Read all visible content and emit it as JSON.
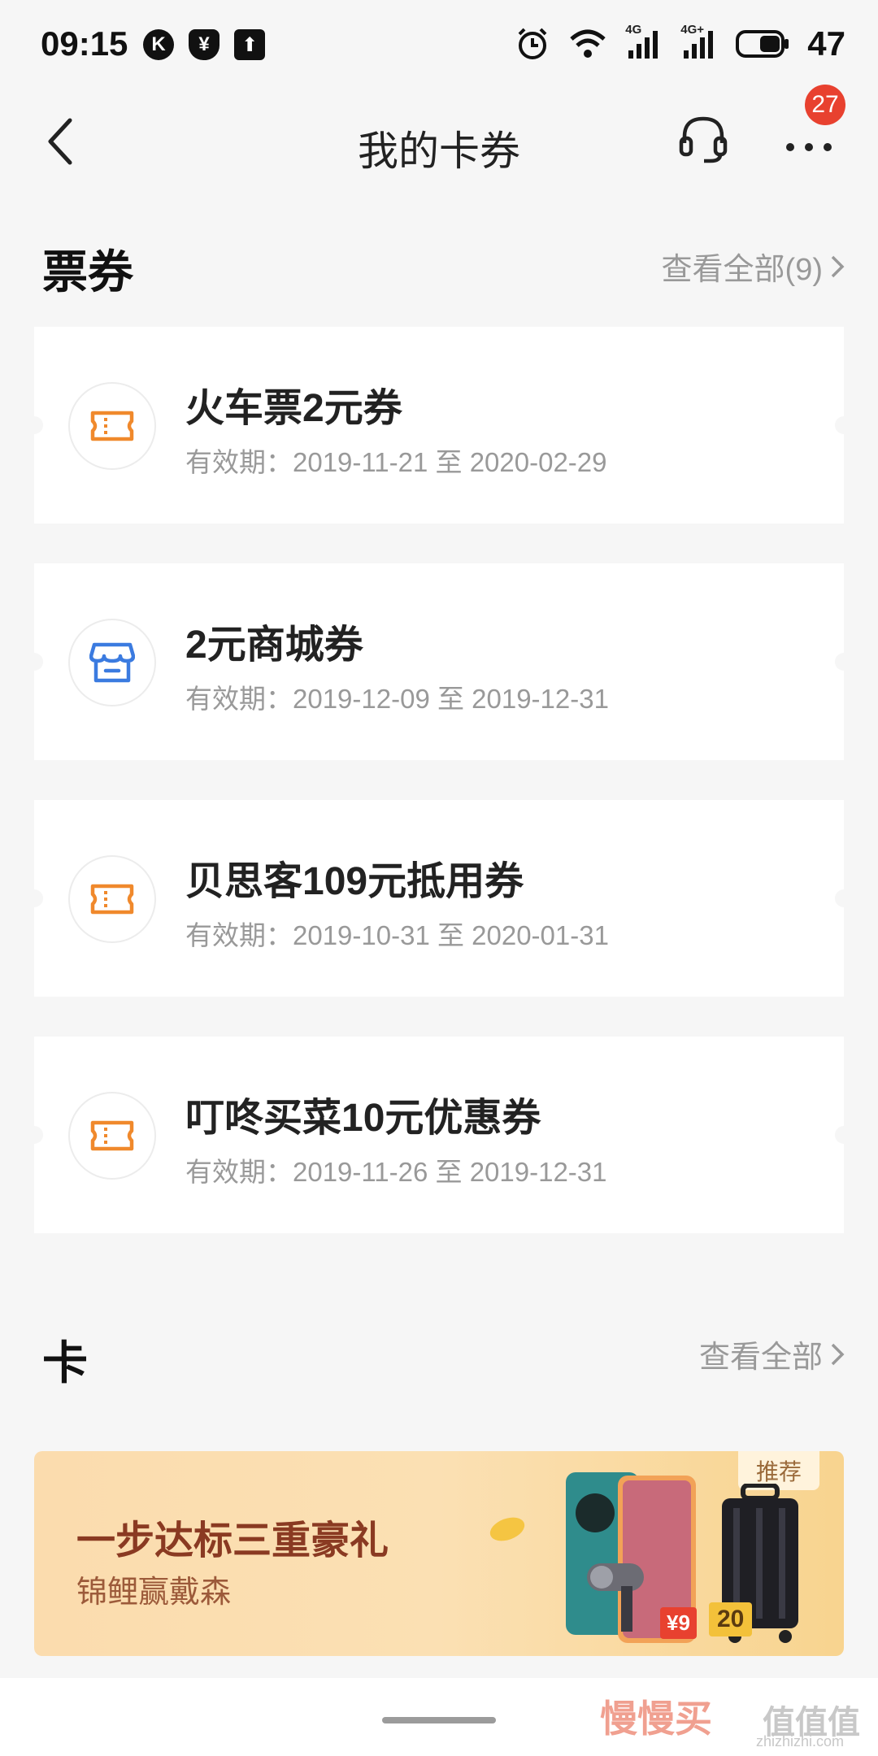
{
  "status": {
    "time": "09:15",
    "battery": "47",
    "net1": "4G",
    "net2": "4G+"
  },
  "nav": {
    "title": "我的卡券",
    "badge": "27"
  },
  "tickets_section": {
    "title": "票券",
    "view_all": "查看全部(9)"
  },
  "coupons": [
    {
      "title": "火车票2元券",
      "date": "有效期：2019-11-21 至 2020-02-29",
      "icon": "ticket-icon"
    },
    {
      "title": "2元商城券",
      "date": "有效期：2019-12-09 至 2019-12-31",
      "icon": "store-icon"
    },
    {
      "title": "贝思客109元抵用券",
      "date": "有效期：2019-10-31 至 2020-01-31",
      "icon": "ticket-icon"
    },
    {
      "title": "叮咚买菜10元优惠券",
      "date": "有效期：2019-11-26 至 2019-12-31",
      "icon": "ticket-icon"
    }
  ],
  "cards_section": {
    "title": "卡",
    "view_all": "查看全部"
  },
  "banner": {
    "title": "一步达标三重豪礼",
    "subtitle": "锦鲤赢戴森",
    "tag": "推荐",
    "price1": "¥9",
    "price2": "20"
  },
  "watermark": {
    "left": "慢慢买",
    "right": "值值值",
    "site": "zhizhizhi.com"
  },
  "colors": {
    "ticket_orange": "#f0892c",
    "store_blue": "#3b7be0",
    "badge_red": "#e8412f"
  }
}
